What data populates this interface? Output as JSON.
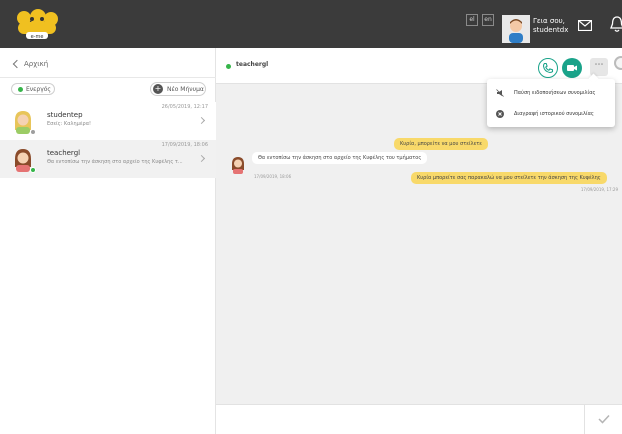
{
  "topbar": {
    "logo_text": "e-me",
    "lang_el": "el",
    "lang_en": "en",
    "greeting_line1": "Γεια σου,",
    "greeting_line2": "studentdx"
  },
  "sidebar": {
    "back_label": "Αρχική",
    "filter_label": "Ενεργός",
    "new_message_label": "Νέο Μήνυμα",
    "conversations": [
      {
        "name": "studentep",
        "preview": "Εσείς: Καλημέρα!",
        "date": "26/05/2019, 12:17",
        "status_color": "#9e9e9e"
      },
      {
        "name": "teachergl",
        "preview": "Θα εντοπίσω την άσκηση στο αρχείο της Κυφέλης τ...",
        "date": "17/09/2019, 18:06",
        "status_color": "#36b54a"
      }
    ]
  },
  "chat": {
    "title": "teachergl",
    "messages": {
      "out1": "Κυρία, μπορείτε να μου στείλετε",
      "out2": "Κυρία μπορείτε σας παρακαλώ να μου στείλετε την άσκηση της Κυφέλης",
      "out2_time": "17/09/2019, 17:29",
      "in1": "Θα εντοπίσω την άσκηση στο αρχείο της Κυφέλης του τμήματος",
      "in1_time": "17/09/2019, 18:06"
    },
    "composer_placeholder": ""
  },
  "dropdown": {
    "mute_label": "Παύση ειδοποιήσεων συνομιλίας",
    "delete_label": "Διαγραφή ιστορικού συνομιλίας"
  },
  "colors": {
    "topbar": "#3b3b3b",
    "accent_teal": "#1aa38a",
    "bubble_out": "#f8d96a",
    "online": "#36b54a"
  }
}
